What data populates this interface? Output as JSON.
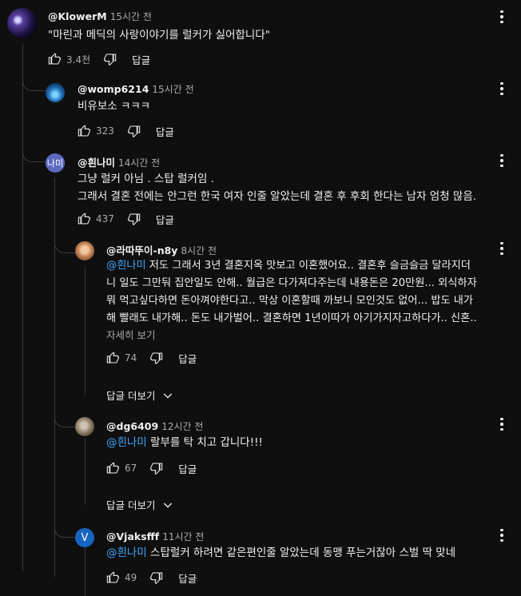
{
  "comments": [
    {
      "author": "@KlowerM",
      "time": "15시간 전",
      "text": "\"마린과 메딕의 사랑이야기를 럴커가 싫어합니다\"",
      "likes": "3.4천",
      "reply": "답글"
    },
    {
      "author": "@womp6214",
      "time": "15시간 전",
      "text": "비유보소 ㅋㅋㅋ",
      "likes": "323",
      "reply": "답글"
    },
    {
      "author": "@흰나미",
      "avatar_text": "나미",
      "time": "14시간 전",
      "text_line1": "그냥 럴커 아님 . 스탑 럴커임 .",
      "text_line2": "그래서 결혼 전에는 안그런 한국 여자 인줄 알았는데 결혼 후 후회 한다는 남자 엄청 많음.",
      "likes": "437",
      "reply": "답글"
    },
    {
      "author": "@라따뚜이-n8y",
      "time": "8시간 전",
      "mention": "@흰나미",
      "text_line1": " 저도 그래서 3년 결혼지옥 맛보고 이혼했어요.. 결혼후 슬금슬금 달라지더",
      "text_line2": "니 일도 그만둬 집안일도 안해.. 월급은 다가져다주는데 내용돈은 20만원... 외식하자",
      "text_line3": "뭐 먹고싶다하면 돈아껴야한다고.. 막상 이혼할때 까보니 모인것도 없어... 밥도 내가",
      "text_line4": "해 빨래도 내가해.. 돈도 내가벌어.. 결혼하면 1년이따가 아기가지자고하다가.. 신혼..",
      "read_more": "자세히 보기",
      "likes": "74",
      "reply": "답글",
      "more_replies": "답글 더보기"
    },
    {
      "author": "@dg6409",
      "time": "12시간 전",
      "mention": "@흰나미",
      "text": " 랄부를 탁 치고 갑니다!!!",
      "likes": "67",
      "reply": "답글",
      "more_replies": "답글 더보기"
    },
    {
      "author": "@Vjaksfff",
      "avatar_text": "V",
      "time": "11시간 전",
      "mention": "@흰나미",
      "text": " 스탑럴커 하려면 같은편인줄 알았는데 동맹 푸는거잖아 스벌 딱 맞네",
      "likes": "49",
      "reply": "답글"
    }
  ],
  "icons": {
    "like": "thumb-up-icon",
    "dislike": "thumb-down-icon",
    "menu": "more-vert-icon",
    "expand": "chevron-down-icon"
  },
  "colors": {
    "background": "#0f0f0f",
    "text": "#f1f1f1",
    "secondary": "#aaaaaa",
    "mention": "#3ea6ff"
  }
}
